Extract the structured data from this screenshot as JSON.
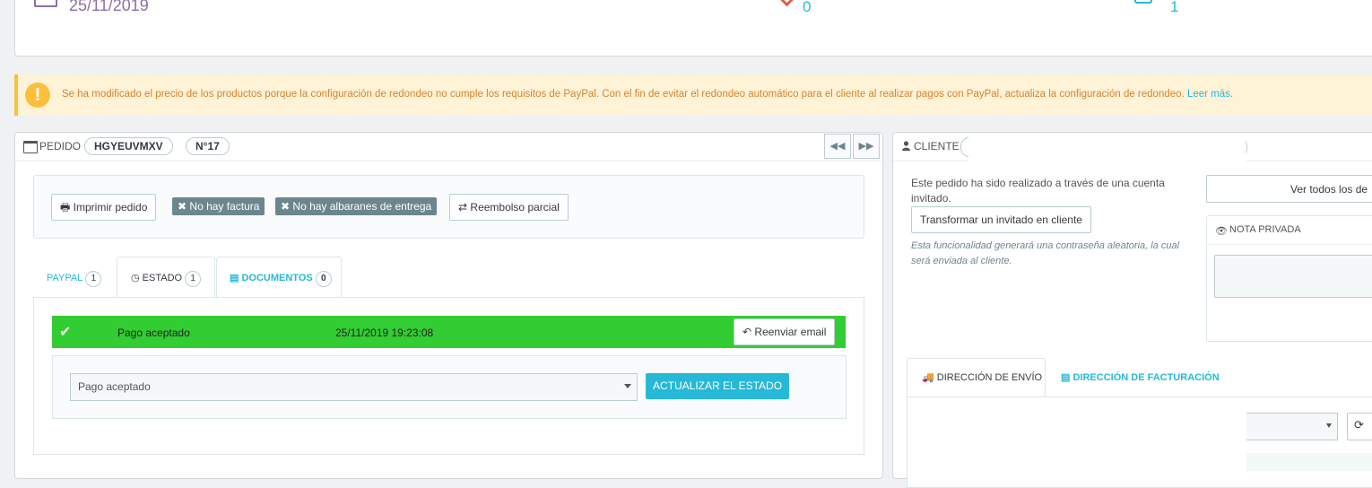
{
  "kpi": {
    "date": "25/11/2019",
    "value_1": "0",
    "value_2": "1"
  },
  "warning": {
    "text": "Se ha modificado el precio de los productos porque la configuración de redondeo no cumple los requisitos de PayPal. Con el fin de evitar el redondeo automático para el cliente al realizar pagos con PayPal, actualiza la configuración de redondeo.",
    "link": "Leer más."
  },
  "order": {
    "title": "PEDIDO",
    "reference": "HGYEUVMXV",
    "number": "N°17",
    "actions": {
      "print": "Imprimir pedido",
      "no_invoice": "No hay factura",
      "no_delivery": "No hay albaranes de entrega",
      "partial_refund": "Reembolso parcial"
    },
    "tabs": [
      {
        "label": "PAYPAL",
        "count": "1"
      },
      {
        "label": "ESTADO",
        "count": "1"
      },
      {
        "label": "DOCUMENTOS",
        "count": "0"
      }
    ],
    "history": {
      "status": "Pago aceptado",
      "date": "25/11/2019 19:23:08",
      "resend": "Reenviar email"
    },
    "state_select": "Pago aceptado",
    "update_button": "ACTUALIZAR EL ESTADO",
    "status_color": "#32cd32"
  },
  "client": {
    "title": "CLIENTE",
    "guest_text": "Este pedido ha sido realizado a través de una cuenta invitado.",
    "transform_button": "Transformar un invitado en cliente",
    "guest_note": "Esta funcionalidad generará una contraseña aleatoria, la cual será enviada al cliente.",
    "see_all": "Ver todos los de",
    "private_note_title": "NOTA PRIVADA",
    "address_tabs": {
      "shipping": "DIRECCIÓN DE ENVÍO",
      "billing": "DIRECCIÓN DE FACTURACIÓN"
    }
  }
}
